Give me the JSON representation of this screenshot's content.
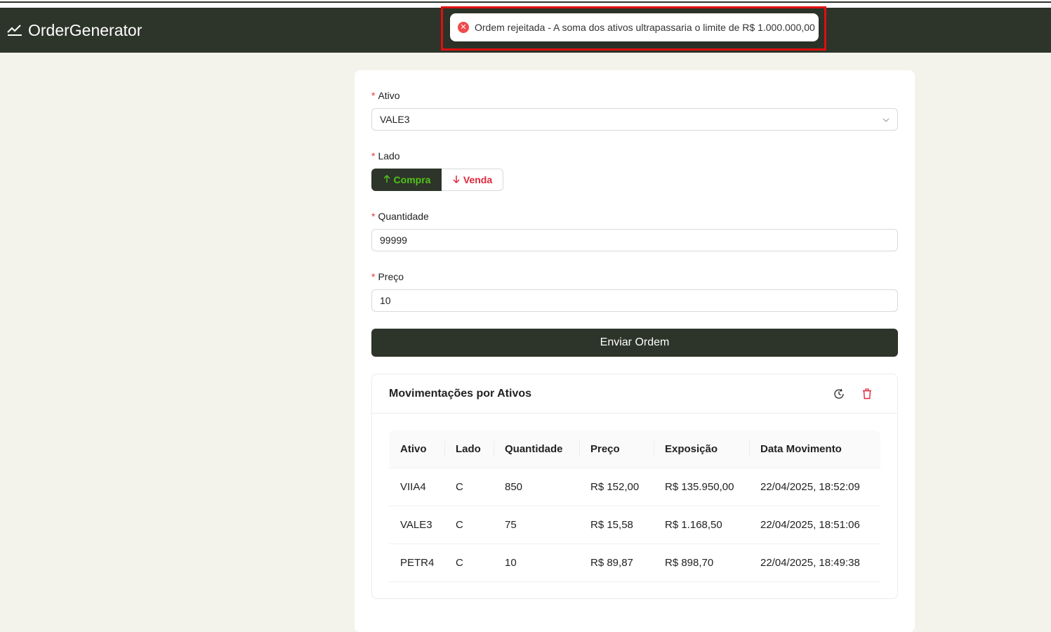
{
  "app": {
    "title": "OrderGenerator"
  },
  "toast": {
    "message": "Ordem rejeitada - A soma dos ativos ultrapassaria o limite de R$ 1.000.000,00"
  },
  "form": {
    "ativo": {
      "label": "Ativo",
      "value": "VALE3"
    },
    "lado": {
      "label": "Lado",
      "buy_label": "Compra",
      "sell_label": "Venda",
      "selected": "Compra"
    },
    "quantidade": {
      "label": "Quantidade",
      "value": "99999"
    },
    "preco": {
      "label": "Preço",
      "value": "10"
    },
    "submit_label": "Enviar Ordem"
  },
  "movements": {
    "title": "Movimentações por Ativos",
    "columns": [
      "Ativo",
      "Lado",
      "Quantidade",
      "Preço",
      "Exposição",
      "Data Movimento"
    ],
    "rows": [
      [
        "VIIA4",
        "C",
        "850",
        "R$ 152,00",
        "R$ 135.950,00",
        "22/04/2025, 18:52:09"
      ],
      [
        "VALE3",
        "C",
        "75",
        "R$ 15,58",
        "R$ 1.168,50",
        "22/04/2025, 18:51:06"
      ],
      [
        "PETR4",
        "C",
        "10",
        "R$ 89,87",
        "R$ 898,70",
        "22/04/2025, 18:49:38"
      ]
    ]
  },
  "colors": {
    "header": "#2d3429",
    "buy": "#52c41a",
    "sell": "#e0263a",
    "error": "#ef4b4b"
  },
  "icons": [
    "stock-chart-icon",
    "error-circle-icon",
    "chevron-down-icon",
    "arrow-up-icon",
    "arrow-down-icon",
    "history-icon",
    "trash-icon"
  ]
}
